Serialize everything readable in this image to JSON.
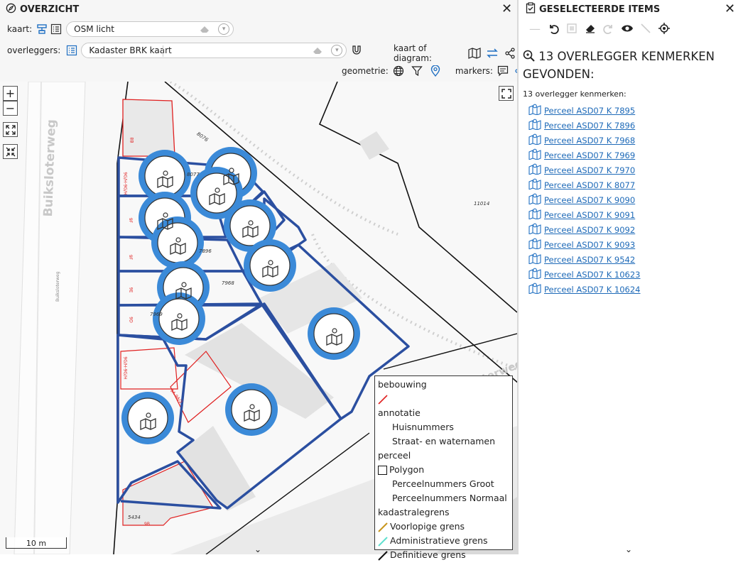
{
  "left_panel": {
    "title": "OVERZICHT",
    "kaart_label": "kaart:",
    "kaart_value": "OSM licht",
    "overleggers_label": "overleggers:",
    "overleggers_value": "Kadaster BRK kaart",
    "kaart_of_diagram_label": "kaart of diagram:",
    "geometrie_label": "geometrie:",
    "markers_label": "markers:"
  },
  "map": {
    "street_names": [
      "Buiksloterweg",
      "Buiksloterweg",
      "Buiksloterweg"
    ],
    "parcel_numbers": [
      "8076",
      "8077",
      "7896",
      "7968",
      "7969",
      "11014",
      "5434"
    ],
    "house_numbers": [
      "8B",
      "9G/H-9G/H",
      "9F",
      "9F",
      "9E",
      "9D",
      "9G/H-9G/H",
      "9A-9A/2",
      "9B"
    ],
    "scale_label": "10 m"
  },
  "legend": {
    "items": [
      {
        "label": "bebouwing",
        "type": "header"
      },
      {
        "label": "",
        "type": "line",
        "color": "#e02020"
      },
      {
        "label": "annotatie",
        "type": "header"
      },
      {
        "label": "Huisnummers",
        "type": "indent"
      },
      {
        "label": "Straat- en waternamen",
        "type": "indent"
      },
      {
        "label": "perceel",
        "type": "header"
      },
      {
        "label": "Polygon",
        "type": "box"
      },
      {
        "label": "Perceelnummers Groot",
        "type": "indent"
      },
      {
        "label": "Perceelnummers Normaal",
        "type": "indent"
      },
      {
        "label": "kadastralegrens",
        "type": "header"
      },
      {
        "label": "Voorlopige grens",
        "type": "line",
        "color": "#c8961e"
      },
      {
        "label": "Administratieve grens",
        "type": "line",
        "color": "#5fe0cf"
      },
      {
        "label": "Definitieve grens",
        "type": "line",
        "color": "#111111"
      }
    ]
  },
  "right_panel": {
    "title": "GESELECTEERDE ITEMS",
    "result_title": "13 OVERLEGGER KENMERKEN GEVONDEN:",
    "result_sub": "13 overlegger kenmerken:",
    "items": [
      "Perceel ASD07 K 7895",
      "Perceel ASD07 K 7896",
      "Perceel ASD07 K 7968",
      "Perceel ASD07 K 7969",
      "Perceel ASD07 K 7970",
      "Perceel ASD07 K 8077",
      "Perceel ASD07 K 9090",
      "Perceel ASD07 K 9091",
      "Perceel ASD07 K 9092",
      "Perceel ASD07 K 9093",
      "Perceel ASD07 K 9542",
      "Perceel ASD07 K 10623",
      "Perceel ASD07 K 10624"
    ]
  },
  "colors": {
    "accent": "#1f6fc2",
    "parcel_stroke": "#2b4fa0",
    "marker_ring": "#3b8ad8",
    "building_outline": "#e02020"
  }
}
